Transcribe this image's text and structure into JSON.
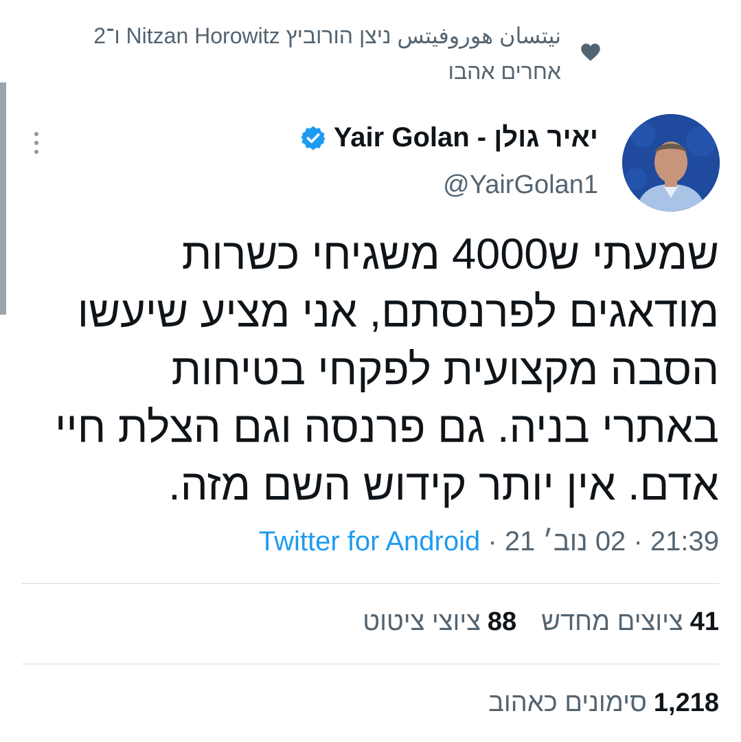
{
  "social_context": {
    "line1": "נ‏יצן הורוביץ Nitzan Horowitz",
    "text_full_line1": "נ‏יצן הורוביץ Nitzan Horowitz",
    "line1_prefix_ar": "نيتسان هوروفيتس",
    "line1_he": "ניצן הורוביץ",
    "line1_en": "Nitzan Horowitz",
    "line1_suffix": "ו־2",
    "line2": "אחרים אהבו"
  },
  "author": {
    "display_name": "יאיר גולן - Yair Golan",
    "handle": "@YairGolan1",
    "verified_icon": "verified-badge-icon"
  },
  "tweet": {
    "lines": [
      "שמעתי ש4000 משגיחי כשרות",
      "מודאגים לפרנסתם, אני מציע שיעשו",
      "הסבה מקצועית לפקחי בטיחות",
      "באתרי בניה. גם פרנסה וגם הצלת חיי",
      "אדם. אין יותר קידוש השם מזה."
    ]
  },
  "meta": {
    "time": "21:39",
    "date": "02 נוב׳ 21",
    "separator": "·",
    "source": "Twitter for Android"
  },
  "stats": {
    "retweets_count": "41",
    "retweets_label": "ציוצים מחדש",
    "quotes_count": "88",
    "quotes_label": "ציוצי ציטוט",
    "likes_count": "1,218",
    "likes_label": "סימונים כאהוב"
  },
  "colors": {
    "text_primary": "#0f1419",
    "text_secondary": "#536471",
    "link": "#1d9bf0",
    "divider": "#cfd9de"
  }
}
